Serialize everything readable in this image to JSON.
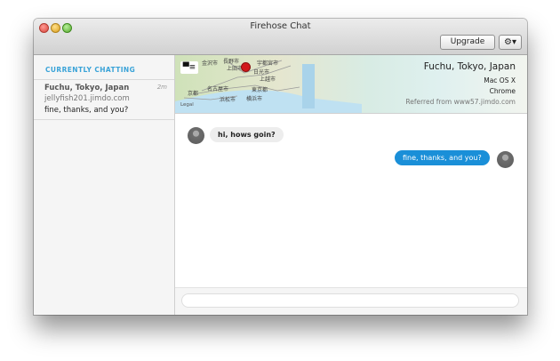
{
  "window": {
    "title": "Firehose Chat",
    "upgrade_label": "Upgrade",
    "gear_glyph": "⚙▾"
  },
  "sidebar": {
    "header": "CURRENTLY CHATTING",
    "items": [
      {
        "location": "Fuchu, Tokyo, Japan",
        "time": "2m",
        "site": "jellyfish201.jimdo.com",
        "last_message": "fine, thanks, and you?"
      }
    ]
  },
  "visitor": {
    "location": "Fuchu, Tokyo, Japan",
    "os": "Mac OS X",
    "browser": "Chrome",
    "referrer": "Referred from www57.jimdo.com"
  },
  "map": {
    "legal": "Legal",
    "labels": [
      "金沢市",
      "長野市",
      "宇都宮市",
      "上田市",
      "日光市",
      "上越市",
      "京都",
      "名古屋市",
      "東京都",
      "浜松市",
      "横浜市"
    ]
  },
  "messages": [
    {
      "from": "visitor",
      "text": "hi, hows goin?"
    },
    {
      "from": "operator",
      "text": "fine, thanks, and you?"
    }
  ],
  "composer": {
    "placeholder": ""
  },
  "colors": {
    "accent": "#3aa3d8",
    "my_bubble": "#1a8fd8",
    "their_bubble": "#ededed"
  }
}
